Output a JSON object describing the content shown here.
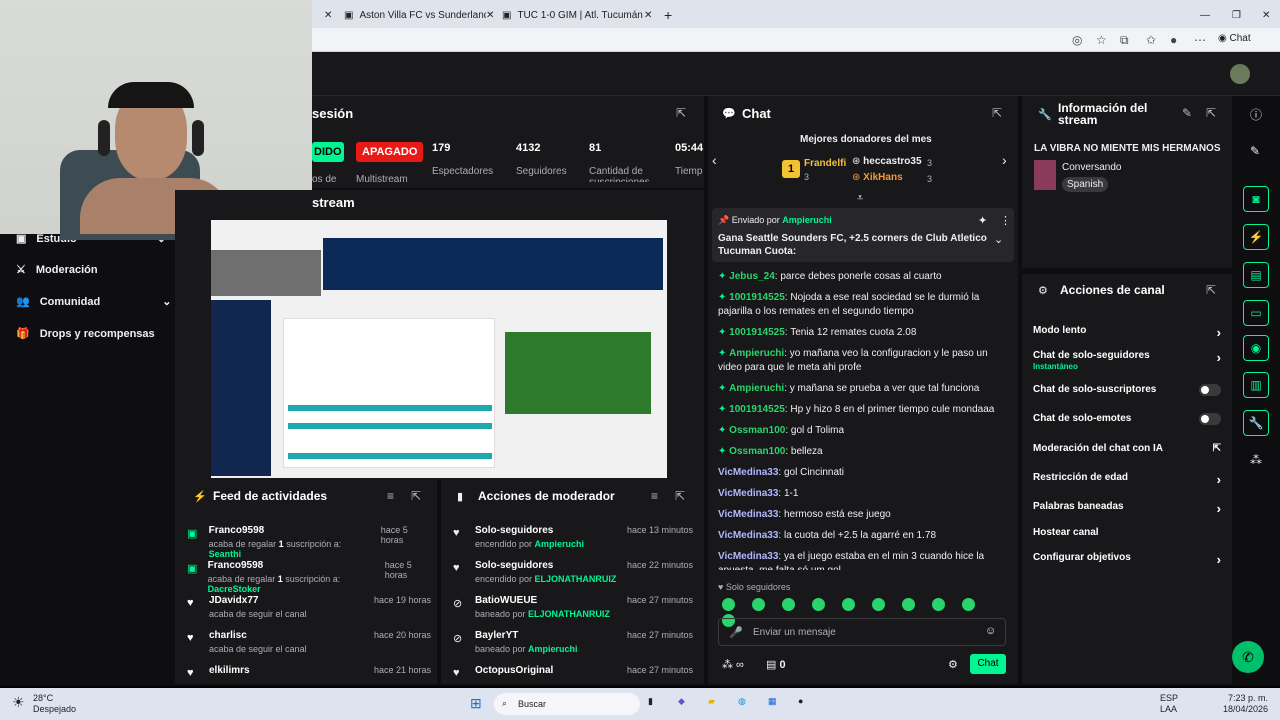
{
  "browser": {
    "tabs": [
      "Aston Villa FC vs Sunderland AFC |",
      "TUC 1-0 GIM | Atl. Tucumán vs Gim"
    ],
    "profile_label": "Chat"
  },
  "stream_manager": {
    "session_title": "sesión",
    "stream_title": "stream",
    "stats": [
      {
        "value": "DIDO",
        "label": "os de"
      },
      {
        "value": "APAGADO",
        "label": "Multistream"
      },
      {
        "value": "179",
        "label": "Espectadores"
      },
      {
        "value": "4132",
        "label": "Seguidores"
      },
      {
        "value": "81",
        "label": "Cantidad de suscripciones"
      },
      {
        "value": "05:44",
        "label": "Tiemp"
      }
    ]
  },
  "sidebar": {
    "items": [
      {
        "label": "Estudio"
      },
      {
        "label": "Moderación"
      },
      {
        "label": "Comunidad"
      },
      {
        "label": "Drops y recompensas"
      }
    ]
  },
  "activity_feed": {
    "title": "Feed de actividades",
    "rows": [
      {
        "name": "Franco9598",
        "time": "hace 5 horas",
        "pre": "acaba de regalar ",
        "count": "1",
        "mid": " suscripción a: ",
        "target": "Seanthi"
      },
      {
        "name": "Franco9598",
        "time": "hace 5 horas",
        "pre": "acaba de regalar ",
        "count": "1",
        "mid": " suscripción a: ",
        "target": "DacreStoker"
      },
      {
        "name": "JDavidx77",
        "time": "hace 19 horas",
        "pre": "acaba de seguir el canal",
        "count": "",
        "mid": "",
        "target": ""
      },
      {
        "name": "charlisc",
        "time": "hace 20 horas",
        "pre": "acaba de seguir el canal",
        "count": "",
        "mid": "",
        "target": ""
      },
      {
        "name": "elkilimrs",
        "time": "hace 21 horas",
        "pre": "",
        "count": "",
        "mid": "",
        "target": ""
      }
    ]
  },
  "mod_actions": {
    "title": "Acciones de moderador",
    "rows": [
      {
        "name": "Solo-seguidores",
        "time": "hace 13 minutos",
        "pre": "encendido por ",
        "target": "Ampieruchi"
      },
      {
        "name": "Solo-seguidores",
        "time": "hace 22 minutos",
        "pre": "encendido por ",
        "target": "ELJONATHANRUIZ"
      },
      {
        "name": "BatioWUEUE",
        "time": "hace 27 minutos",
        "pre": "baneado por ",
        "target": "ELJONATHANRUIZ"
      },
      {
        "name": "BaylerYT",
        "time": "hace 27 minutos",
        "pre": "baneado por ",
        "target": "Ampieruchi"
      },
      {
        "name": "OctopusOriginal",
        "time": "hace 27 minutos",
        "pre": "",
        "target": ""
      }
    ]
  },
  "chat": {
    "title": "Chat",
    "donors_title": "Mejores donadores del mes",
    "donors": [
      {
        "name": "Frandelfi",
        "count": "3",
        "rank": "1"
      },
      {
        "name": "heccastro35",
        "count": "3"
      },
      {
        "name": "XikHans",
        "count": "3"
      }
    ],
    "pinned": {
      "by_label": "Enviado por",
      "by": "Ampieruchi",
      "text": "Gana Seattle Sounders FC, +2.5 corners de Club Atletico Tucuman Cuota:"
    },
    "messages": [
      {
        "user": "Jebus_24",
        "text": "parce debes ponerle cosas al cuarto",
        "color": "#2ad46c"
      },
      {
        "user": "1001914525",
        "text": "Nojoda a ese real sociedad se le durmió la pajarilla o los remates en el segundo tiempo",
        "color": "#2ad46c"
      },
      {
        "user": "1001914525",
        "text": "Tenia 12 remates cuota 2.08",
        "color": "#2ad46c"
      },
      {
        "user": "Ampieruchi",
        "text": "yo mañana veo la configuracion y le paso un video para que le meta ahi profe",
        "color": "#2ad46c"
      },
      {
        "user": "Ampieruchi",
        "text": "y mañana se prueba a ver que tal funciona",
        "color": "#2ad46c"
      },
      {
        "user": "1001914525",
        "text": "Hp y hizo 8 en el primer tiempo cule mondaaa",
        "color": "#2ad46c"
      },
      {
        "user": "Ossman100",
        "text": "gol d Tolima",
        "color": "#2ad46c"
      },
      {
        "user": "Ossman100",
        "text": "belleza",
        "color": "#2ad46c"
      },
      {
        "user": "VicMedina33",
        "text": "gol Cincinnati",
        "color": "#b0b8ff"
      },
      {
        "user": "VicMedina33",
        "text": "1-1",
        "color": "#b0b8ff"
      },
      {
        "user": "VicMedina33",
        "text": "hermoso está ese juego",
        "color": "#b0b8ff"
      },
      {
        "user": "VicMedina33",
        "text": "la cuota del +2.5 la agarré en 1.78",
        "color": "#b0b8ff"
      },
      {
        "user": "VicMedina33",
        "text": "ya el juego estaba en el min 3 cuando hice la apuesta. me falta só um gol",
        "color": "#b0b8ff"
      }
    ],
    "mode_label": "Solo seguidores",
    "input_placeholder": "Enviar un mensaje",
    "send_label": "Chat",
    "points": "0"
  },
  "stream_info": {
    "title": "Información del stream",
    "stream_name": "LA VIBRA NO MIENTE MIS HERMANOS",
    "category": "Conversando",
    "language": "Spanish"
  },
  "channel_actions": {
    "title": "Acciones de canal",
    "items": [
      {
        "label": "Modo lento",
        "sub": "",
        "control": "chevron"
      },
      {
        "label": "Chat de solo-seguidores",
        "sub": "Instantáneo",
        "control": "chevron"
      },
      {
        "label": "Chat de solo-suscriptores",
        "sub": "",
        "control": "toggle"
      },
      {
        "label": "Chat de solo-emotes",
        "sub": "",
        "control": "toggle"
      },
      {
        "label": "Moderación del chat con IA",
        "sub": "",
        "control": "external"
      },
      {
        "label": "Restricción de edad",
        "sub": "",
        "control": "chevron"
      },
      {
        "label": "Palabras baneadas",
        "sub": "",
        "control": "chevron"
      },
      {
        "label": "Hostear canal",
        "sub": "",
        "control": "none"
      },
      {
        "label": "Configurar objetivos",
        "sub": "",
        "control": "chevron"
      }
    ]
  },
  "taskbar": {
    "weather_temp": "28°C",
    "weather_desc": "Despejado",
    "search": "Buscar",
    "lang1": "ESP",
    "lang2": "LAA",
    "time": "7:23 p. m.",
    "date": "18/04/2026"
  },
  "colors": {
    "accent": "#00f593",
    "bg": "#0e0e10",
    "panel": "#18181b",
    "danger": "#e91916"
  }
}
